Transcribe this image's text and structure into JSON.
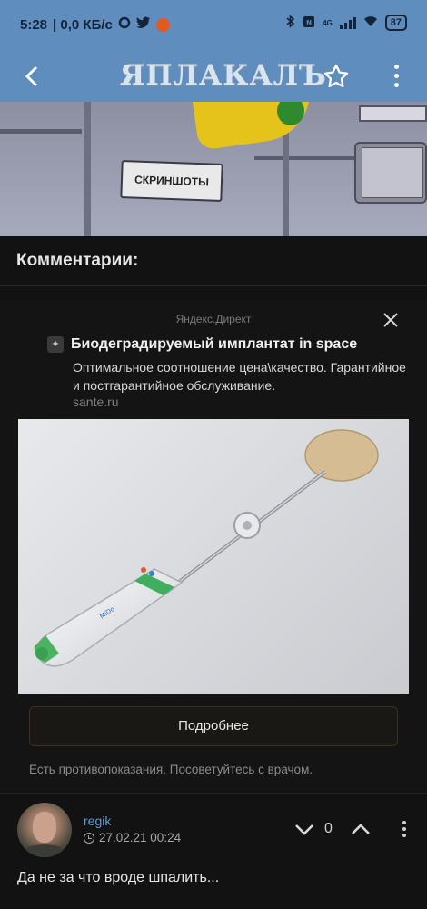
{
  "status_bar": {
    "time": "5:28",
    "network_speed": "| 0,0 КБ/с",
    "network_type": "4G",
    "battery": "87",
    "icons": [
      "circle-app-icon",
      "twitter-icon",
      "notification-icon",
      "bluetooth-icon",
      "nfc-icon",
      "wifi-icon",
      "signal-icon",
      "battery-icon"
    ]
  },
  "app_bar": {
    "logo": "ЯПЛАКАЛЪ",
    "back_icon": "arrow-left-icon",
    "star_icon": "star-outline-icon",
    "menu_icon": "more-vertical-icon",
    "color": "#5f8dbd"
  },
  "post_image": {
    "sign_text": "СКРИНШОТЫ"
  },
  "comments_section": {
    "title": "Комментарии:"
  },
  "ad": {
    "source": "Яндекс.Директ",
    "title": "Биодеградируемый имплантат in space",
    "description": "Оптимальное соотношение цена\\качество. Гарантийное и постгарантийное обслуживание.",
    "domain": "sante.ru",
    "button_label": "Подробнее",
    "warning": "Есть противопоказания. Посоветуйтесь с врачом."
  },
  "comment": {
    "username": "regik",
    "timestamp": "27.02.21 00:24",
    "rating": "0",
    "text": "Да не за что вроде шпалить..."
  },
  "colors": {
    "background": "#121212",
    "username": "#5d9bd6",
    "accent": "#5f8dbd"
  }
}
